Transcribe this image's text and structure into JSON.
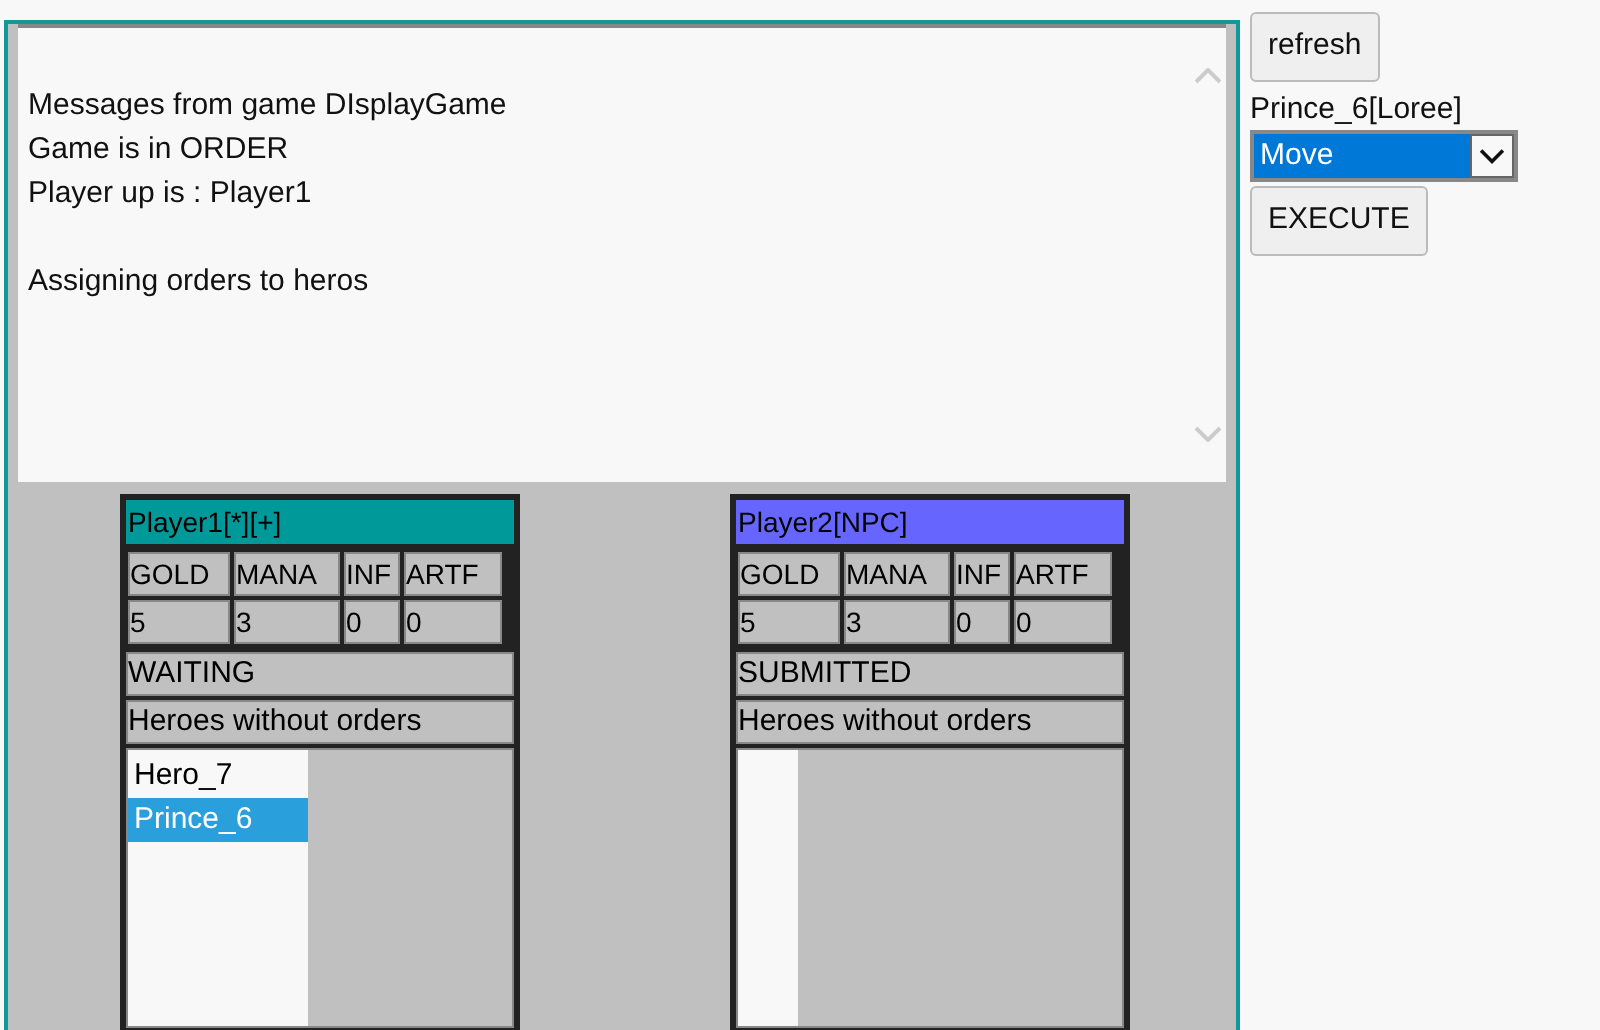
{
  "message_groups": [
    [
      "Messages from game DIsplayGame",
      "Game is in ORDER",
      "Player up is : Player1"
    ],
    [
      "Assigning orders to heros"
    ]
  ],
  "players": [
    {
      "name": "Player1[*][+]",
      "color": "#009999",
      "stats": [
        {
          "label": "GOLD",
          "value": "5"
        },
        {
          "label": "MANA",
          "value": "3"
        },
        {
          "label": "INF",
          "value": "0"
        },
        {
          "label": "ARTF",
          "value": "0"
        }
      ],
      "status": "WAITING",
      "heroes_label": "Heroes without orders",
      "heroes": [
        {
          "name": "Hero_7",
          "selected": false
        },
        {
          "name": "Prince_6",
          "selected": true
        }
      ]
    },
    {
      "name": "Player2[NPC]",
      "color": "#6666ff",
      "stats": [
        {
          "label": "GOLD",
          "value": "5"
        },
        {
          "label": "MANA",
          "value": "3"
        },
        {
          "label": "INF",
          "value": "0"
        },
        {
          "label": "ARTF",
          "value": "0"
        }
      ],
      "status": "SUBMITTED",
      "heroes_label": "Heroes without orders"
    }
  ],
  "controls": {
    "refresh": "refresh",
    "hero": "Prince_6[Loree]",
    "order": {
      "value": "Move"
    },
    "execute": "EXECUTE"
  }
}
